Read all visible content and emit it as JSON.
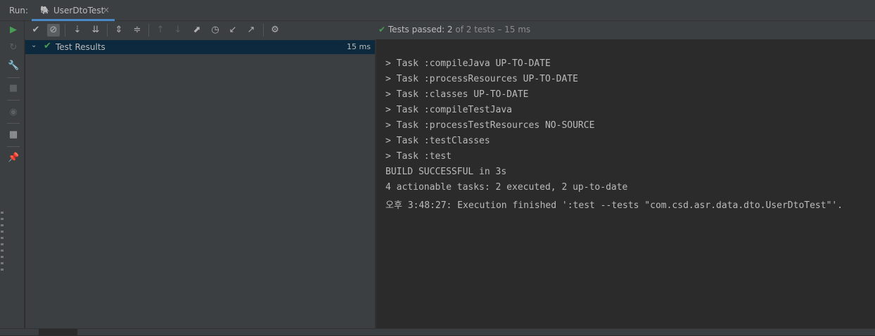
{
  "run_panel": {
    "label": "Run:",
    "tab": {
      "title": "UserDtoTest",
      "icon": "gradle-elephant-icon",
      "close": "×"
    }
  },
  "left_toolbar": {
    "icons": [
      "rerun-icon",
      "rerun-failed-icon",
      "wrench-icon",
      "stop-icon",
      "eye-icon",
      "layout-icon",
      "pin-icon"
    ]
  },
  "test_toolbar": {
    "icons": [
      "show-passed-icon",
      "show-ignored-icon",
      "sort-alphabetically-icon",
      "sort-by-duration-icon",
      "expand-all-icon",
      "collapse-all-icon",
      "previous-failed-icon",
      "next-failed-icon",
      "import-tests-icon",
      "history-icon",
      "export-icon",
      "open-editor-icon",
      "settings-icon"
    ]
  },
  "status": {
    "prefix": "Tests passed: ",
    "passed": "2",
    "rest": " of 2 tests – 15 ms"
  },
  "tree": {
    "root_label": "Test Results",
    "root_duration": "15 ms"
  },
  "console": {
    "lines": [
      "> Task :compileJava UP-TO-DATE",
      "> Task :processResources UP-TO-DATE",
      "> Task :classes UP-TO-DATE",
      "> Task :compileTestJava",
      "> Task :processTestResources NO-SOURCE",
      "> Task :testClasses",
      "> Task :test",
      "BUILD SUCCESSFUL in 3s",
      "4 actionable tasks: 2 executed, 2 up-to-date",
      "오후 3:48:27: Execution finished ':test --tests \"com.csd.asr.data.dto.UserDtoTest\"'."
    ]
  },
  "colors": {
    "success": "#499c54",
    "selection": "#0d293e",
    "accent": "#4a88c7"
  }
}
